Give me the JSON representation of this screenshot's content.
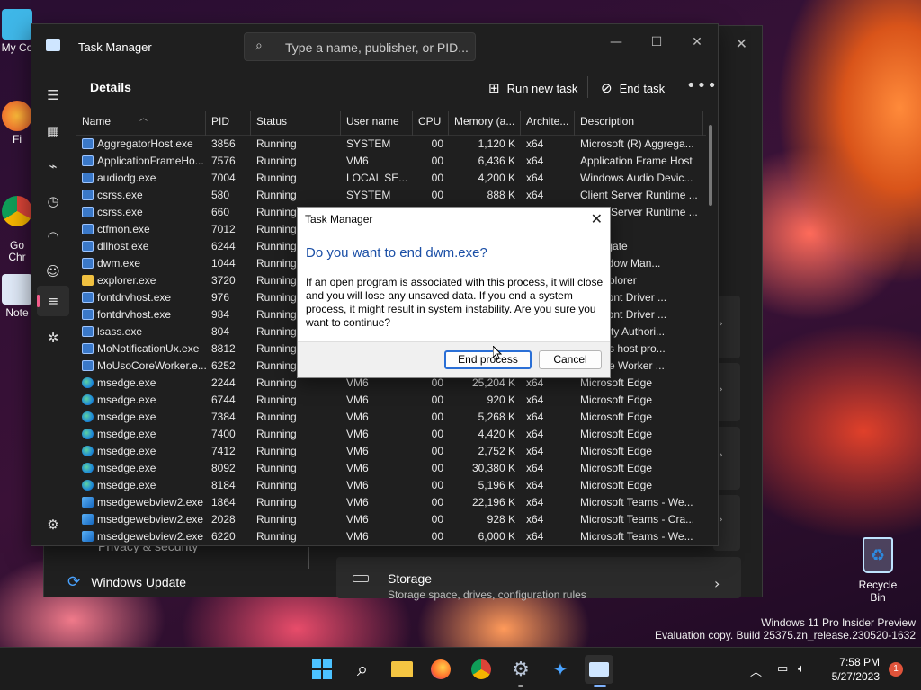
{
  "desktop": {
    "icons": [
      {
        "label": "My Co"
      },
      {
        "label": "Fi"
      },
      {
        "label": "Go\nChr"
      },
      {
        "label": "Note"
      }
    ],
    "recycle_bin_label": "Recycle Bin",
    "watermark_line1": "Windows 11 Pro Insider Preview",
    "watermark_line2": "Evaluation copy. Build 25375.zn_release.230520-1632"
  },
  "settings": {
    "link_privacy": "Privacy & security",
    "windows_update_label": "Windows Update",
    "storage_title": "Storage",
    "storage_subtitle": "Storage space, drives, configuration rules"
  },
  "task_manager": {
    "title": "Task Manager",
    "search_placeholder": "Type a name, publisher, or PID...",
    "page_title": "Details",
    "run_new_task_label": "Run new task",
    "end_task_label": "End task",
    "more_label": "•••",
    "columns": [
      "Name",
      "PID",
      "Status",
      "User name",
      "CPU",
      "Memory (a...",
      "Archite...",
      "Description"
    ],
    "rows": [
      {
        "icon": "exe",
        "name": "AggregatorHost.exe",
        "pid": "3856",
        "status": "Running",
        "user": "SYSTEM",
        "cpu": "00",
        "memory": "1,120 K",
        "arch": "x64",
        "desc": "Microsoft (R) Aggrega..."
      },
      {
        "icon": "exe",
        "name": "ApplicationFrameHo...",
        "pid": "7576",
        "status": "Running",
        "user": "VM6",
        "cpu": "00",
        "memory": "6,436 K",
        "arch": "x64",
        "desc": "Application Frame Host"
      },
      {
        "icon": "exe",
        "name": "audiodg.exe",
        "pid": "7004",
        "status": "Running",
        "user": "LOCAL SE...",
        "cpu": "00",
        "memory": "4,200 K",
        "arch": "x64",
        "desc": "Windows Audio Devic..."
      },
      {
        "icon": "exe",
        "name": "csrss.exe",
        "pid": "580",
        "status": "Running",
        "user": "SYSTEM",
        "cpu": "00",
        "memory": "888 K",
        "arch": "x64",
        "desc": "Client Server Runtime ..."
      },
      {
        "icon": "exe",
        "name": "csrss.exe",
        "pid": "660",
        "status": "Running",
        "user": "SYSTEM",
        "cpu": "00",
        "memory": "",
        "arch": "",
        "desc": "Client Server Runtime ..."
      },
      {
        "icon": "exe",
        "name": "ctfmon.exe",
        "pid": "7012",
        "status": "Running",
        "user": "",
        "cpu": "",
        "memory": "",
        "arch": "",
        "desc": "oader"
      },
      {
        "icon": "exe",
        "name": "dllhost.exe",
        "pid": "6244",
        "status": "Running",
        "user": "",
        "cpu": "",
        "memory": "",
        "arch": "",
        "desc": "Surrogate"
      },
      {
        "icon": "exe",
        "name": "dwm.exe",
        "pid": "1044",
        "status": "Running",
        "user": "",
        "cpu": "",
        "memory": "",
        "arch": "",
        "desc": "p Window Man..."
      },
      {
        "icon": "explorer",
        "name": "explorer.exe",
        "pid": "3720",
        "status": "Running",
        "user": "",
        "cpu": "",
        "memory": "",
        "arch": "",
        "desc": "ws Explorer"
      },
      {
        "icon": "exe",
        "name": "fontdrvhost.exe",
        "pid": "976",
        "status": "Running",
        "user": "",
        "cpu": "",
        "memory": "",
        "arch": "",
        "desc": "ode Font Driver ..."
      },
      {
        "icon": "exe",
        "name": "fontdrvhost.exe",
        "pid": "984",
        "status": "Running",
        "user": "",
        "cpu": "",
        "memory": "",
        "arch": "",
        "desc": "ode Font Driver ..."
      },
      {
        "icon": "exe",
        "name": "lsass.exe",
        "pid": "804",
        "status": "Running",
        "user": "",
        "cpu": "",
        "memory": "",
        "arch": "",
        "desc": "Security Authori..."
      },
      {
        "icon": "exe",
        "name": "MoNotificationUx.exe",
        "pid": "8812",
        "status": "Running",
        "user": "",
        "cpu": "",
        "memory": "",
        "arch": "",
        "desc": "cations host pro..."
      },
      {
        "icon": "exe",
        "name": "MoUsoCoreWorker.e...",
        "pid": "6252",
        "status": "Running",
        "user": "",
        "cpu": "",
        "memory": "",
        "arch": "",
        "desc": "O Core Worker ..."
      },
      {
        "icon": "edge",
        "name": "msedge.exe",
        "pid": "2244",
        "status": "Running",
        "user": "VM6",
        "cpu": "00",
        "memory": "25,204 K",
        "arch": "x64",
        "desc": "Microsoft Edge"
      },
      {
        "icon": "edge",
        "name": "msedge.exe",
        "pid": "6744",
        "status": "Running",
        "user": "VM6",
        "cpu": "00",
        "memory": "920 K",
        "arch": "x64",
        "desc": "Microsoft Edge"
      },
      {
        "icon": "edge",
        "name": "msedge.exe",
        "pid": "7384",
        "status": "Running",
        "user": "VM6",
        "cpu": "00",
        "memory": "5,268 K",
        "arch": "x64",
        "desc": "Microsoft Edge"
      },
      {
        "icon": "edge",
        "name": "msedge.exe",
        "pid": "7400",
        "status": "Running",
        "user": "VM6",
        "cpu": "00",
        "memory": "4,420 K",
        "arch": "x64",
        "desc": "Microsoft Edge"
      },
      {
        "icon": "edge",
        "name": "msedge.exe",
        "pid": "7412",
        "status": "Running",
        "user": "VM6",
        "cpu": "00",
        "memory": "2,752 K",
        "arch": "x64",
        "desc": "Microsoft Edge"
      },
      {
        "icon": "edge",
        "name": "msedge.exe",
        "pid": "8092",
        "status": "Running",
        "user": "VM6",
        "cpu": "00",
        "memory": "30,380 K",
        "arch": "x64",
        "desc": "Microsoft Edge"
      },
      {
        "icon": "edge",
        "name": "msedge.exe",
        "pid": "8184",
        "status": "Running",
        "user": "VM6",
        "cpu": "00",
        "memory": "5,196 K",
        "arch": "x64",
        "desc": "Microsoft Edge"
      },
      {
        "icon": "webview",
        "name": "msedgewebview2.exe",
        "pid": "1864",
        "status": "Running",
        "user": "VM6",
        "cpu": "00",
        "memory": "22,196 K",
        "arch": "x64",
        "desc": "Microsoft Teams - We..."
      },
      {
        "icon": "webview",
        "name": "msedgewebview2.exe",
        "pid": "2028",
        "status": "Running",
        "user": "VM6",
        "cpu": "00",
        "memory": "928 K",
        "arch": "x64",
        "desc": "Microsoft Teams - Cra..."
      },
      {
        "icon": "webview",
        "name": "msedgewebview2.exe",
        "pid": "6220",
        "status": "Running",
        "user": "VM6",
        "cpu": "00",
        "memory": "6,000 K",
        "arch": "x64",
        "desc": "Microsoft Teams - We..."
      }
    ]
  },
  "dialog": {
    "title": "Task Manager",
    "heading": "Do you want to end dwm.exe?",
    "body": "If an open program is associated with this process, it will close and you will lose any unsaved data. If you end a system process, it might result in system instability. Are you sure you want to continue?",
    "end_process_label": "End process",
    "cancel_label": "Cancel"
  },
  "taskbar": {
    "time": "7:58 PM",
    "date": "5/27/2023",
    "notification_count": "1"
  },
  "colors": {
    "accent_pink": "#f25c8a",
    "dialog_heading": "#1b4fa6",
    "primary_button_border": "#2a6fd6"
  }
}
